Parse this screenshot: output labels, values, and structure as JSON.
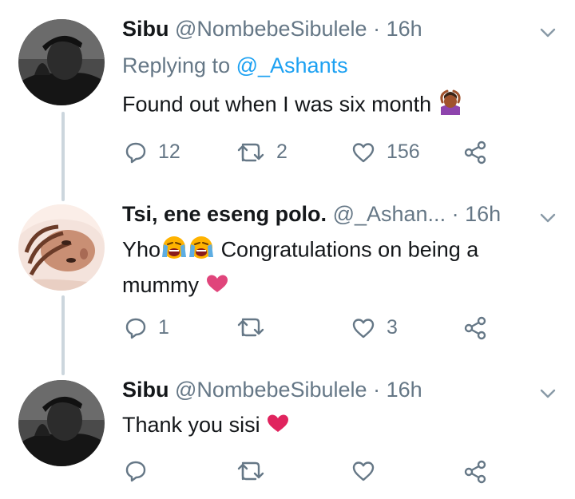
{
  "tweets": [
    {
      "display_name": "Sibu",
      "handle": "@NombebeSibulele",
      "time": "· 16h",
      "replying_prefix": "Replying to",
      "replying_handle": "@_Ashants",
      "text": "Found out when I was six month",
      "emoji": "woman-gesturing-ok-emoji",
      "reply_count": "12",
      "retweet_count": "2",
      "like_count": "156"
    },
    {
      "display_name": "Tsi, ene eseng polo.",
      "handle": "@_Ashan...",
      "time": "· 16h",
      "text_prefix": "Yho",
      "text_line1": "Congratulations on being a",
      "text_line2": "mummy",
      "reply_count": "1",
      "retweet_count": "",
      "like_count": "3"
    },
    {
      "display_name": "Sibu",
      "handle": "@NombebeSibulele",
      "time": "· 16h",
      "text": "Thank you sisi",
      "reply_count": "",
      "retweet_count": "",
      "like_count": ""
    }
  ],
  "colors": {
    "text_primary": "#14171a",
    "text_secondary": "#657786",
    "link": "#1da1f2",
    "thread_line": "#ccd6dd",
    "heart_pink": "#e0457b",
    "heart_red": "#e0245e"
  },
  "icons": [
    "reply-icon",
    "retweet-icon",
    "like-icon",
    "share-icon",
    "chevron-down-icon"
  ]
}
